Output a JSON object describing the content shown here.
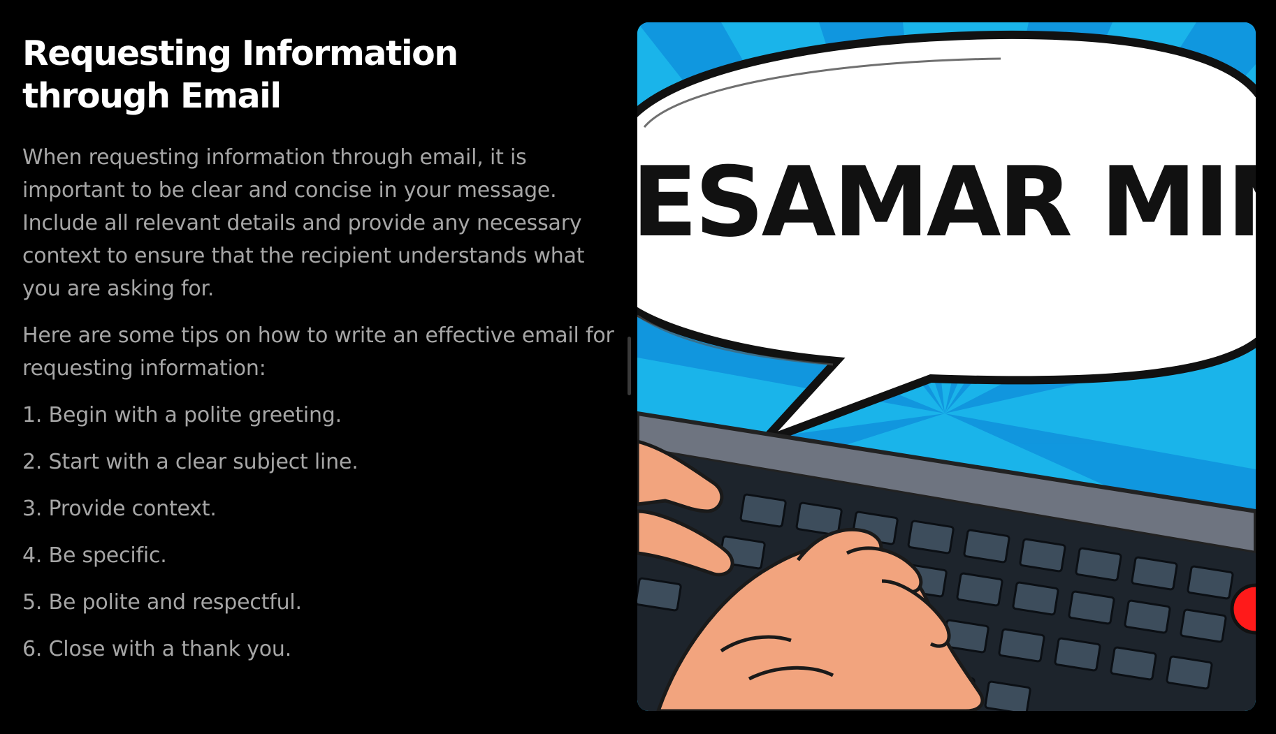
{
  "slide": {
    "title": "Requesting Information through Email",
    "paragraphs": [
      "When requesting information through email, it is important to be clear and concise in your message. Include all relevant details and provide any necessary context to ensure that the recipient understands what you are asking for.",
      "Here are some tips on how to write an effective email for requesting information:"
    ],
    "steps": [
      "1. Begin with a polite greeting.",
      "2. Start with a clear subject line.",
      "3. Provide context.",
      "4. Be specific.",
      "5. Be polite and respectful.",
      "6. Close with a thank you."
    ]
  },
  "illustration": {
    "speech_bubble_text": "ESAMAR MING",
    "description_icon": "comic-typing-hands-illustration",
    "colors": {
      "sky": "#1ab4ea",
      "sky_dark": "#0a7fd6",
      "bubble": "#ffffff",
      "skin": "#f2a47e",
      "keyboard": "#2a3440",
      "record_dot": "#ff1a1a"
    }
  },
  "theme": {
    "background": "#000000",
    "title_color": "#ffffff",
    "body_color": "#a6a6a6"
  }
}
